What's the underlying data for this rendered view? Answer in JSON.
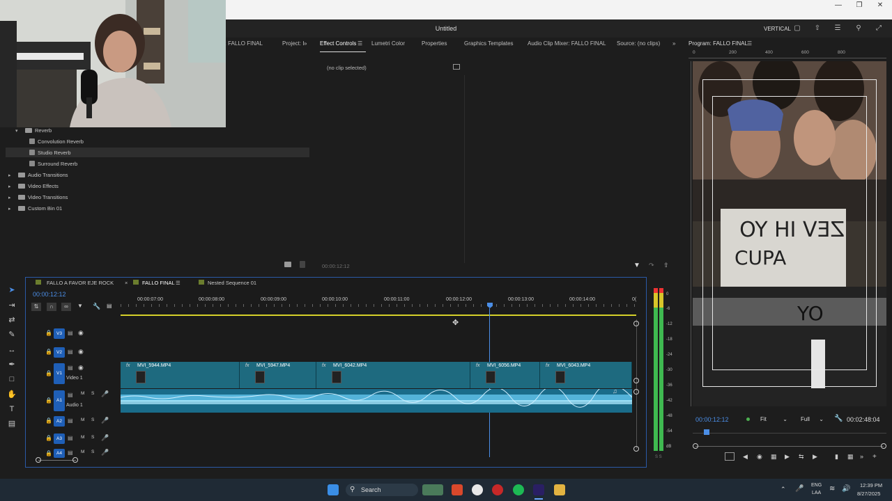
{
  "app": {
    "title": "Untitled",
    "workspace": "VERTICAL"
  },
  "effects_panel": {
    "tabs": [
      "r: FALLO FINAL",
      "Project: I"
    ],
    "tree": [
      {
        "label": "Reverb",
        "type": "folder",
        "open": true
      },
      {
        "label": "Convolution Reverb",
        "type": "effect"
      },
      {
        "label": "Studio Reverb",
        "type": "effect",
        "selected": true
      },
      {
        "label": "Surround Reverb",
        "type": "effect"
      },
      {
        "label": "Audio Transitions",
        "type": "folder"
      },
      {
        "label": "Video Effects",
        "type": "folder"
      },
      {
        "label": "Video Transitions",
        "type": "folder"
      },
      {
        "label": "Custom Bin 01",
        "type": "folder"
      }
    ]
  },
  "effect_controls": {
    "tabs": [
      "Effect Controls",
      "Lumetri Color",
      "Properties",
      "Graphics Templates",
      "Audio Clip Mixer: FALLO FINAL",
      "Source: (no clips)"
    ],
    "no_clip": "(no clip selected)",
    "timecode": "00:00:12:12"
  },
  "program": {
    "title": "Program: FALLO FINAL",
    "ruler": [
      "0",
      "200",
      "400",
      "600",
      "800"
    ],
    "timecode": "00:00:12:12",
    "fit": "Fit",
    "quality": "Full",
    "duration": "00:02:48:04"
  },
  "timeline": {
    "tabs": [
      "FALLO A FAVOR EJE ROCK",
      "FALLO FINAL",
      "Nested Sequence 01"
    ],
    "timecode": "00:00:12:12",
    "ruler_ticks": [
      "00:00:07:00",
      "00:00:08:00",
      "00:00:09:00",
      "00:00:10:00",
      "00:00:11:00",
      "00:00:12:00",
      "00:00:13:00",
      "00:00:14:00",
      "0("
    ],
    "tracks": [
      {
        "id": "V3",
        "kind": "video"
      },
      {
        "id": "V2",
        "kind": "video"
      },
      {
        "id": "V1",
        "kind": "video",
        "name": "Video 1"
      },
      {
        "id": "A1",
        "kind": "audio",
        "name": "Audio 1"
      },
      {
        "id": "A2",
        "kind": "audio"
      },
      {
        "id": "A3",
        "kind": "audio"
      },
      {
        "id": "A4",
        "kind": "audio"
      }
    ],
    "track_buttons": {
      "mute": "M",
      "solo": "S"
    },
    "clips": [
      {
        "name": "MVI_5944.MP4",
        "fx": "fx"
      },
      {
        "name": "MVI_5947.MP4",
        "fx": "fx"
      },
      {
        "name": "MVI_6042.MP4",
        "fx": "fx"
      },
      {
        "name": "MVI_6056.MP4",
        "fx": "fx"
      },
      {
        "name": "MVI_6043.MP4",
        "fx": "fx"
      }
    ]
  },
  "audio_meter": {
    "labels": [
      "0",
      "-6",
      "-12",
      "-18",
      "-24",
      "-30",
      "-36",
      "-42",
      "-48",
      "-54",
      "dB"
    ],
    "footer": "S S"
  },
  "taskbar": {
    "search": "Search",
    "lang1": "ENG",
    "lang2": "LAA",
    "time": "12:39 PM",
    "date": "8/27/2025"
  }
}
